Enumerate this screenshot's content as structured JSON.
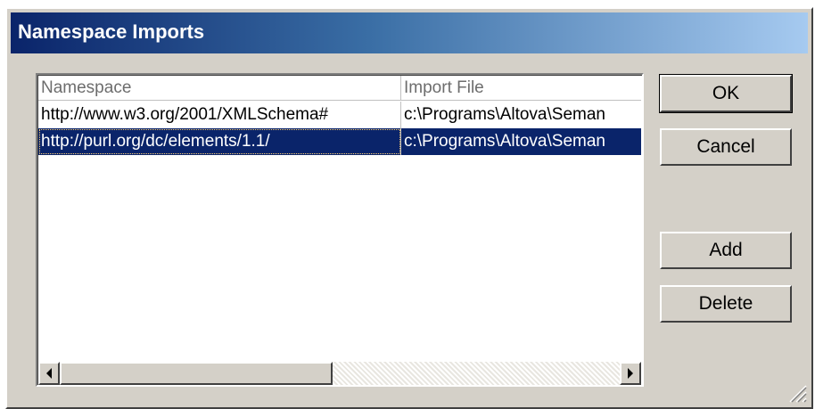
{
  "dialog": {
    "title": "Namespace Imports"
  },
  "table": {
    "columns": [
      "Namespace",
      "Import File"
    ],
    "rows": [
      {
        "namespace": "http://www.w3.org/2001/XMLSchema#",
        "import_file": "c:\\Programs\\Altova\\Seman",
        "selected": false
      },
      {
        "namespace": "http://purl.org/dc/elements/1.1/",
        "import_file": "c:\\Programs\\Altova\\Seman",
        "selected": true
      }
    ]
  },
  "buttons": {
    "ok": "OK",
    "cancel": "Cancel",
    "add": "Add",
    "delete": "Delete"
  },
  "icons": {
    "scroll_left": "arrow-left-icon",
    "scroll_right": "arrow-right-icon",
    "resize_grip": "resize-grip-icon"
  },
  "colors": {
    "selection": "#0a246a",
    "titlebar_start": "#0a246a",
    "titlebar_end": "#a6caf0",
    "face": "#d4d0c8"
  }
}
